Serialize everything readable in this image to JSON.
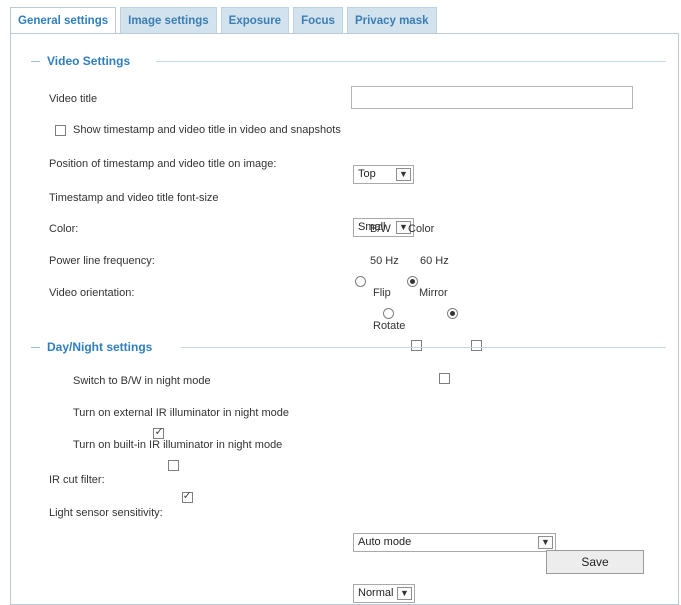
{
  "tabs": [
    "General settings",
    "Image settings",
    "Exposure",
    "Focus",
    "Privacy mask"
  ],
  "video_settings": {
    "title": "Video Settings",
    "video_title_label": "Video title",
    "video_title_value": "",
    "show_timestamp_label": "Show timestamp and video title in video and snapshots",
    "show_timestamp_checked": false,
    "position_label": "Position of timestamp and video title on image:",
    "position_value": "Top",
    "font_size_label": "Timestamp and video title font-size",
    "font_size_value": "Small",
    "color_label": "Color:",
    "color_options": [
      "B/W",
      "Color"
    ],
    "color_selected": "Color",
    "power_label": "Power line frequency:",
    "power_options": [
      "50 Hz",
      "60 Hz"
    ],
    "power_selected": "60 Hz",
    "orientation_label": "Video orientation:",
    "flip_label": "Flip",
    "mirror_label": "Mirror",
    "rotate_label": "Rotate"
  },
  "day_night": {
    "title": "Day/Night settings",
    "switch_bw_label": "Switch to B/W in night mode",
    "switch_bw_checked": true,
    "external_ir_label": "Turn on external IR illuminator in night mode",
    "external_ir_checked": false,
    "builtin_ir_label": "Turn on built-in IR illuminator in night mode",
    "builtin_ir_checked": true,
    "ir_cut_label": "IR cut filter:",
    "ir_cut_value": "Auto mode",
    "light_sensor_label": "Light sensor sensitivity:",
    "light_sensor_value": "Normal"
  },
  "save_label": "Save",
  "colors": {
    "accent": "#2f7fbd",
    "tab_bg": "#d2e3ee",
    "border": "#b9cbd8"
  }
}
